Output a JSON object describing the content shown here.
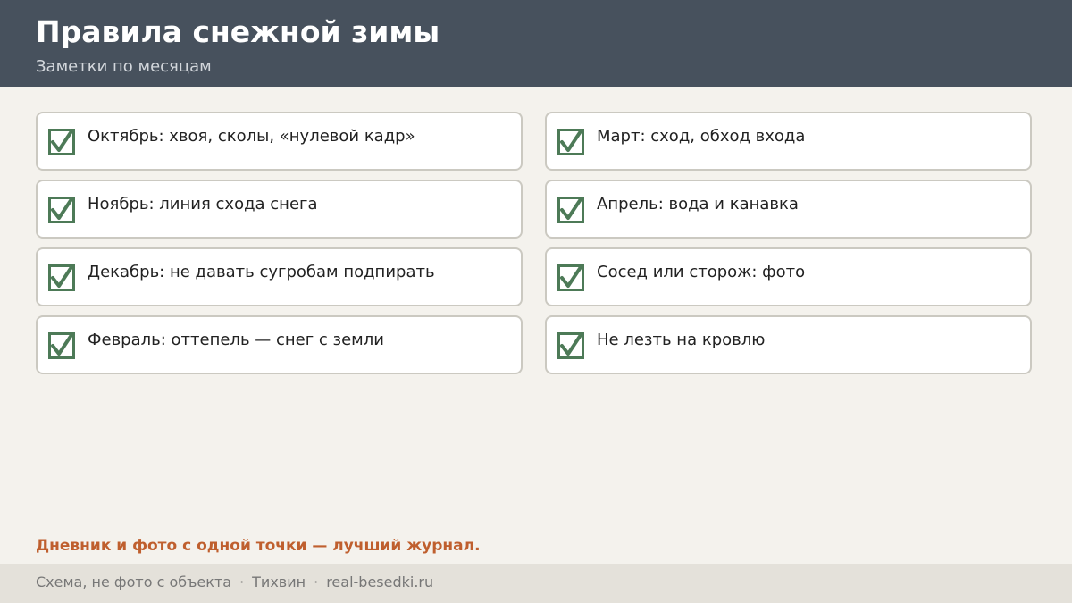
{
  "header": {
    "title": "Правила снежной зимы",
    "subtitle": "Заметки по месяцам"
  },
  "checklist": {
    "left": [
      "Октябрь: хвоя, сколы, «нулевой кадр»",
      "Ноябрь: линия схода снега",
      "Декабрь: не давать сугробам подпирать",
      "Февраль: оттепель — снег с земли"
    ],
    "right": [
      "Март: сход, обход входа",
      "Апрель: вода и канавка",
      "Сосед или сторож: фото",
      "Не лезть на кровлю"
    ],
    "icon": "checkbox-checked-icon"
  },
  "tip": "Дневник и фото с одной точки — лучший журнал.",
  "footer": {
    "note": "Схема, не фото с объекта",
    "separator": "·",
    "city": "Тихвин",
    "site": "real-besedki.ru"
  },
  "colors": {
    "header_bg": "#47515d",
    "page_bg": "#f4f2ed",
    "check_green": "#4d7a57",
    "accent_orange": "#bf5f2e",
    "footer_bg": "#e4e1da"
  }
}
